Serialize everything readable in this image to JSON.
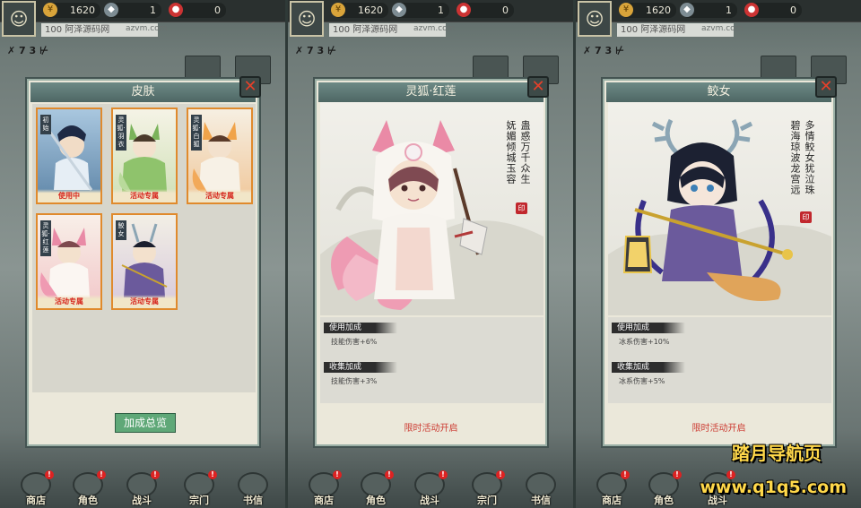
{
  "hud": {
    "gold": "1620",
    "gem": "1",
    "red": "0",
    "player_id": "100 阿泽源码网",
    "id_suffix": "azvm.com",
    "flag_tag": "✗ 7 3 ⊬"
  },
  "nav": {
    "shop": "商店",
    "hero": "角色",
    "battle": "战斗",
    "sect": "宗门",
    "mail": "书信",
    "badge": "!"
  },
  "skin_dialog": {
    "title": "皮肤",
    "summary_button": "加成总览",
    "cards": [
      {
        "tag": "初始",
        "footer": "使用中"
      },
      {
        "tag": "灵狐·羽衣",
        "footer": "活动专属"
      },
      {
        "tag": "灵狐·白狐",
        "footer": "活动专属"
      },
      {
        "tag": "灵狐·红莲",
        "footer": "活动专属"
      },
      {
        "tag": "鲛女",
        "footer": "活动专属"
      }
    ]
  },
  "fox_dialog": {
    "title": "灵狐·红莲",
    "poem_col1": "妩媚倾城玉容",
    "poem_col2": "蛊惑万千众生",
    "seal": "印",
    "use_bonus_label": "使用加成",
    "use_bonus_value": "技能伤害+6%",
    "collect_bonus_label": "收集加成",
    "collect_bonus_value": "技能伤害+3%",
    "footer": "限时活动开启"
  },
  "shark_dialog": {
    "title": "鲛女",
    "poem_col1": "碧海琼波龙宫远",
    "poem_col2": "多情鲛女犹泣珠",
    "seal": "印",
    "use_bonus_label": "使用加成",
    "use_bonus_value": "冰系伤害+10%",
    "collect_bonus_label": "收集加成",
    "collect_bonus_value": "冰系伤害+5%",
    "footer": "限时活动开启"
  },
  "watermark": {
    "line1": "踏月导航页",
    "line2": "www.q1q5.com"
  },
  "colors": {
    "accent_green": "#5fa878",
    "title_bar": "#5b7773",
    "alert_red": "#cc3b32",
    "card_border": "#e08a2c"
  }
}
